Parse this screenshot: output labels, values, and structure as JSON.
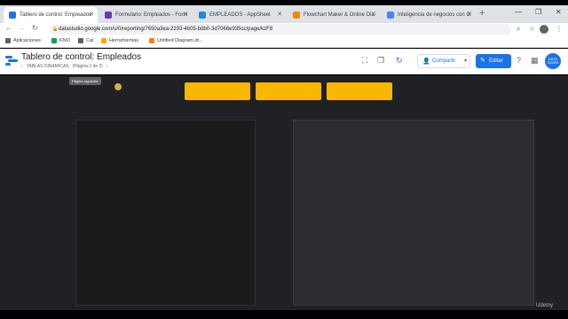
{
  "browser": {
    "tabs": [
      {
        "label": "Tablero de control: Empleados",
        "icon_color": "#1a73e8",
        "active": true
      },
      {
        "label": "Formulario: Empleados - Form",
        "icon_color": "#673ab7",
        "active": false
      },
      {
        "label": "EMPLEADOS - AppSheet",
        "icon_color": "#1e88e5",
        "active": false
      },
      {
        "label": "Flowchart Maker & Online Dia",
        "icon_color": "#f08705",
        "active": false
      },
      {
        "label": "Inteligencia de negocios con G",
        "icon_color": "#4285f4",
        "active": false
      }
    ],
    "new_tab_icon": "plus-icon",
    "window_controls": [
      "minimize-icon",
      "maximize-icon",
      "close-icon"
    ],
    "url": "datastudio.google.com/u/0/reporting/7650a3ea-2193-4b05-bdb0-3d7066e935cc/page/kzF8",
    "bookmarks": [
      {
        "label": "Aplicaciones",
        "icon_color": "#5f6368"
      },
      {
        "label": "KNO",
        "icon_color": "#0f9d58"
      },
      {
        "label": "Cal",
        "icon_color": "#5f6368"
      },
      {
        "label": "Herramientas",
        "icon_color": "#f9ab00"
      },
      {
        "label": "Untitled Diagram.dr...",
        "icon_color": "#f08705"
      }
    ]
  },
  "report": {
    "title": "Tablero de control: Empleados",
    "page_name": "TABLAS DINAMICAS",
    "page_count": "(Página 2 de 2)",
    "share_label": "Compartir",
    "edit_label": "Editar",
    "user_badge": "DATA SCIEN",
    "tooltip": "Página siguiente",
    "accent_color": "#1a73e8",
    "button_color": "#f9b700",
    "canvas_color": "#202124"
  },
  "watermark": "Udemy"
}
